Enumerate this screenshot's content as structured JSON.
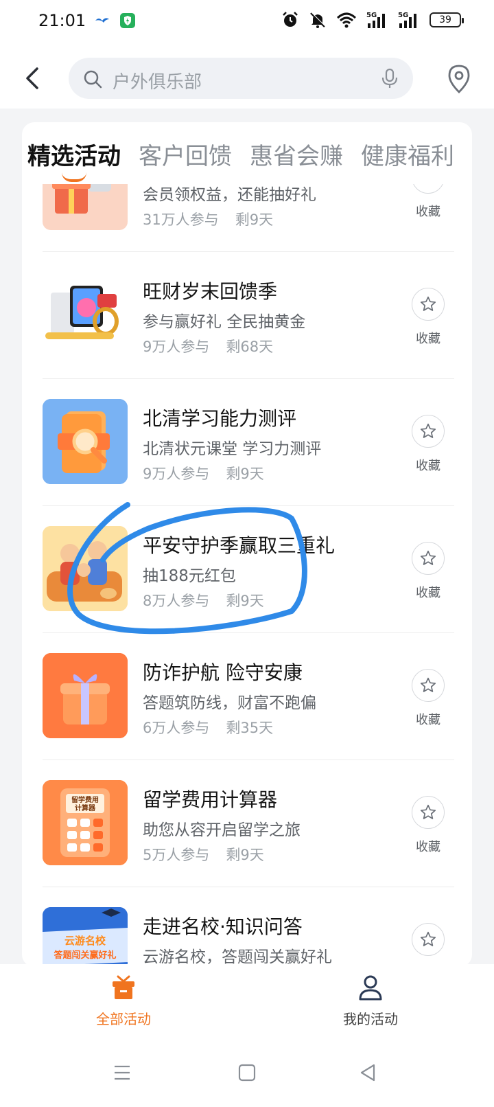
{
  "status_bar": {
    "time": "21:01",
    "battery": "39",
    "icons": [
      "bird-app-icon",
      "shield-app-icon",
      "alarm-icon",
      "mute-icon",
      "wifi-icon",
      "signal-5g-icon",
      "signal-5g-icon"
    ]
  },
  "header": {
    "search_placeholder": "户外俱乐部",
    "icons": [
      "back-arrow-icon",
      "search-icon",
      "microphone-icon",
      "location-pin-icon"
    ]
  },
  "tabs": [
    {
      "label": "精选活动",
      "active": true
    },
    {
      "label": "客户回馈",
      "active": false
    },
    {
      "label": "惠省会赚",
      "active": false
    },
    {
      "label": "健康福利",
      "active": false
    }
  ],
  "items": [
    {
      "title": "",
      "desc": "会员领权益，还能抽好礼",
      "participants": "31万人参与",
      "remaining": "剩9天",
      "fav": "收藏"
    },
    {
      "title": "旺财岁末回馈季",
      "desc": "参与赢好礼 全民抽黄金",
      "participants": "9万人参与",
      "remaining": "剩68天",
      "fav": "收藏"
    },
    {
      "title": "北清学习能力测评",
      "desc": "北清状元课堂 学习力测评",
      "participants": "9万人参与",
      "remaining": "剩9天",
      "fav": "收藏"
    },
    {
      "title": "平安守护季赢取三重礼",
      "desc": "抽188元红包",
      "participants": "8万人参与",
      "remaining": "剩9天",
      "fav": "收藏"
    },
    {
      "title": "防诈护航 险守安康",
      "desc": "答题筑防线，财富不跑偏",
      "participants": "6万人参与",
      "remaining": "剩35天",
      "fav": "收藏"
    },
    {
      "title": "留学费用计算器",
      "desc": "助您从容开启留学之旅",
      "participants": "5万人参与",
      "remaining": "剩9天",
      "fav": "收藏"
    },
    {
      "title": "走进名校·知识问答",
      "desc": "云游名校，答题闯关赢好礼",
      "participants": "",
      "remaining": "",
      "fav": "收藏"
    }
  ],
  "thumb_text": {
    "calculator_line1": "留学费用",
    "calculator_line2": "计算器",
    "school_line1": "云游名校",
    "school_line2": "答题闯关赢好礼"
  },
  "bottom_nav": {
    "all_activities": "全部活动",
    "my_activities": "我的活动"
  },
  "colors": {
    "accent": "#f0741f",
    "annotation": "#2f8ae8"
  }
}
